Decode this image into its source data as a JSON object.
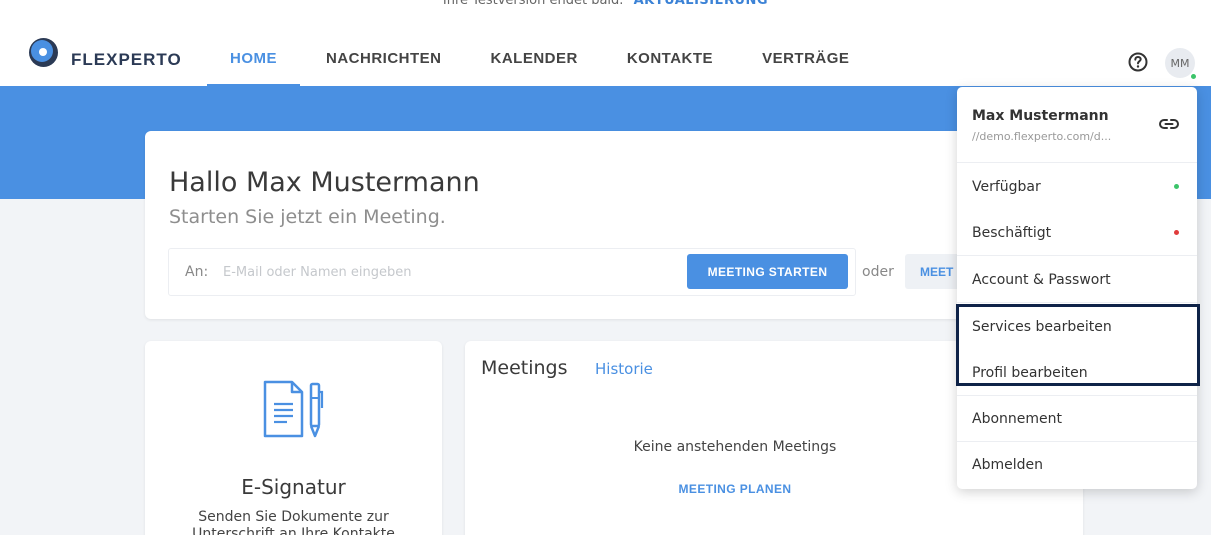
{
  "trial_banner": {
    "text": "Ihre Testversion endet bald.",
    "link": "AKTUALISIERUNG"
  },
  "header": {
    "brand": "FLEXPERTO",
    "tabs": [
      {
        "label": "HOME",
        "active": true
      },
      {
        "label": "NACHRICHTEN"
      },
      {
        "label": "KALENDER"
      },
      {
        "label": "KONTAKTE"
      },
      {
        "label": "VERTRÄGE"
      }
    ],
    "help_icon": "help-circle-icon",
    "avatar_initials": "MM"
  },
  "main": {
    "greeting": "Hallo Max Mustermann",
    "subline": "Starten Sie jetzt ein Meeting.",
    "invite_label": "An:",
    "invite_placeholder": "E-Mail oder Namen eingeben",
    "start_button": "MEETING STARTEN",
    "or_text": "oder",
    "meet_button": "MEET"
  },
  "signature_card": {
    "icon": "document-pen-icon",
    "title": "E-Signatur",
    "description": "Senden Sie Dokumente zur Unterschrift an Ihre Kontakte"
  },
  "meetings_card": {
    "title": "Meetings",
    "history_link": "Historie",
    "empty_text": "Keine anstehenden Meetings",
    "plan_link": "MEETING PLANEN"
  },
  "user_menu": {
    "name": "Max Mustermann",
    "url": "//demo.flexperto.com/d...",
    "link_icon": "link-icon",
    "items": [
      {
        "label": "Verfügbar",
        "status_color": "#3cc46a"
      },
      {
        "label": "Beschäftigt",
        "status_color": "#e03c3c"
      },
      {
        "label": "Account & Passwort"
      },
      {
        "label": "Services bearbeiten"
      },
      {
        "label": "Profil bearbeiten"
      },
      {
        "label": "Abonnement"
      },
      {
        "label": "Abmelden"
      }
    ]
  },
  "colors": {
    "accent": "#4a90e2",
    "brand_dark": "#2b3a55",
    "highlight_border": "#0f2348"
  }
}
